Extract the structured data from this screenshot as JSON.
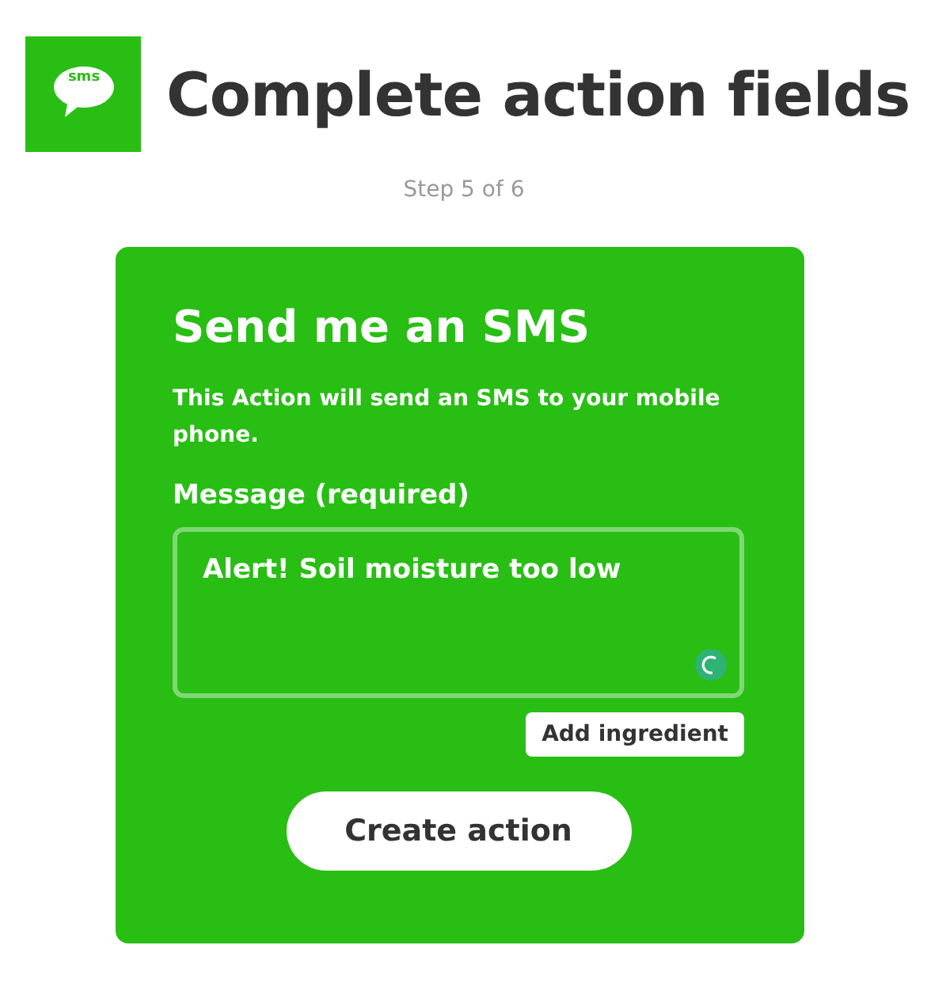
{
  "header": {
    "logo_text": "sms",
    "title": "Complete action fields",
    "step": "Step 5 of 6"
  },
  "card": {
    "title": "Send me an SMS",
    "description": "This Action will send an SMS to your mobile phone.",
    "field": {
      "label": "Message (required)",
      "value": "Alert! Soil moisture too low"
    },
    "add_button": "Add ingredient",
    "submit_button": "Create action"
  }
}
